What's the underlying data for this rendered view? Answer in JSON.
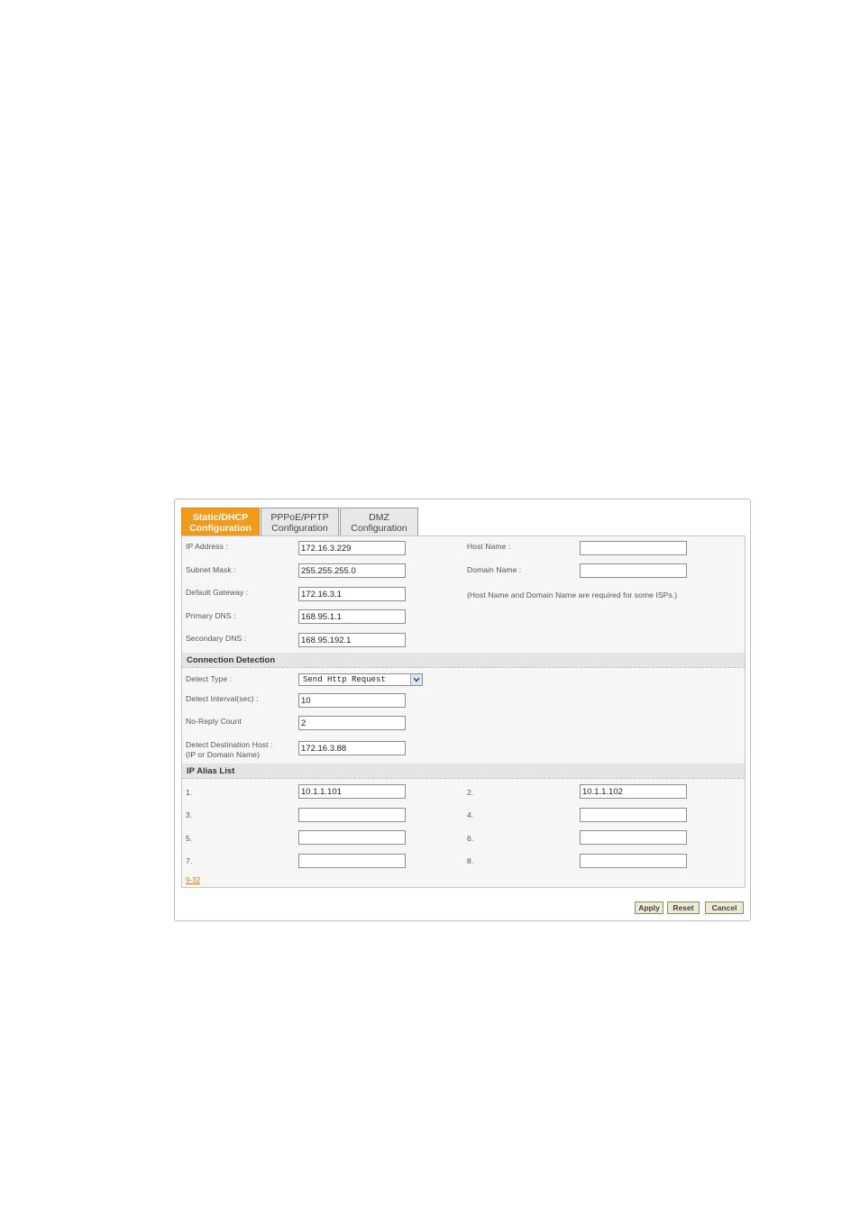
{
  "tabs": [
    {
      "line1": "Static/DHCP",
      "line2": "Configuration",
      "active": true
    },
    {
      "line1": "PPPoE/PPTP",
      "line2": "Configuration",
      "active": false
    },
    {
      "line1": "DMZ",
      "line2": "Configuration",
      "active": false
    }
  ],
  "wan": {
    "ip_label": "IP Address :",
    "ip_value": "172.16.3.229",
    "subnet_label": "Subnet Mask :",
    "subnet_value": "255.255.255.0",
    "gateway_label": "Default Gateway :",
    "gateway_value": "172.16.3.1",
    "dns1_label": "Primary DNS :",
    "dns1_value": "168.95.1.1",
    "dns2_label": "Secondary DNS :",
    "dns2_value": "168.95.192.1",
    "host_label": "Host Name :",
    "host_value": "",
    "domain_label": "Domain Name :",
    "domain_value": "",
    "note": "(Host Name and Domain Name are required for some ISPs.)"
  },
  "connection": {
    "title": "Connection Detection",
    "type_label": "Detect Type :",
    "type_value": "Send Http Request",
    "interval_label": "Detect Interval(sec) :",
    "interval_value": "10",
    "noreply_label": "No-Reply Count",
    "noreply_value": "2",
    "host_label_1": "Detect Destination Host :",
    "host_label_2": "(IP or Domain Name)",
    "host_value": "172.16.3.88"
  },
  "alias": {
    "title": "IP Alias List",
    "items": [
      {
        "label": "1.",
        "value": "10.1.1.101"
      },
      {
        "label": "2.",
        "value": "10.1.1.102"
      },
      {
        "label": "3.",
        "value": ""
      },
      {
        "label": "4.",
        "value": ""
      },
      {
        "label": "5.",
        "value": ""
      },
      {
        "label": "6.",
        "value": ""
      },
      {
        "label": "7.",
        "value": ""
      },
      {
        "label": "8.",
        "value": ""
      }
    ]
  },
  "page_ref": "9-32",
  "buttons": {
    "apply": "Apply",
    "reset": "Reset",
    "cancel": "Cancel"
  },
  "colors": {
    "active_tab": "#f29a1a",
    "panel_bg": "#f6f6f6",
    "section_bg": "#e4e4e4"
  }
}
